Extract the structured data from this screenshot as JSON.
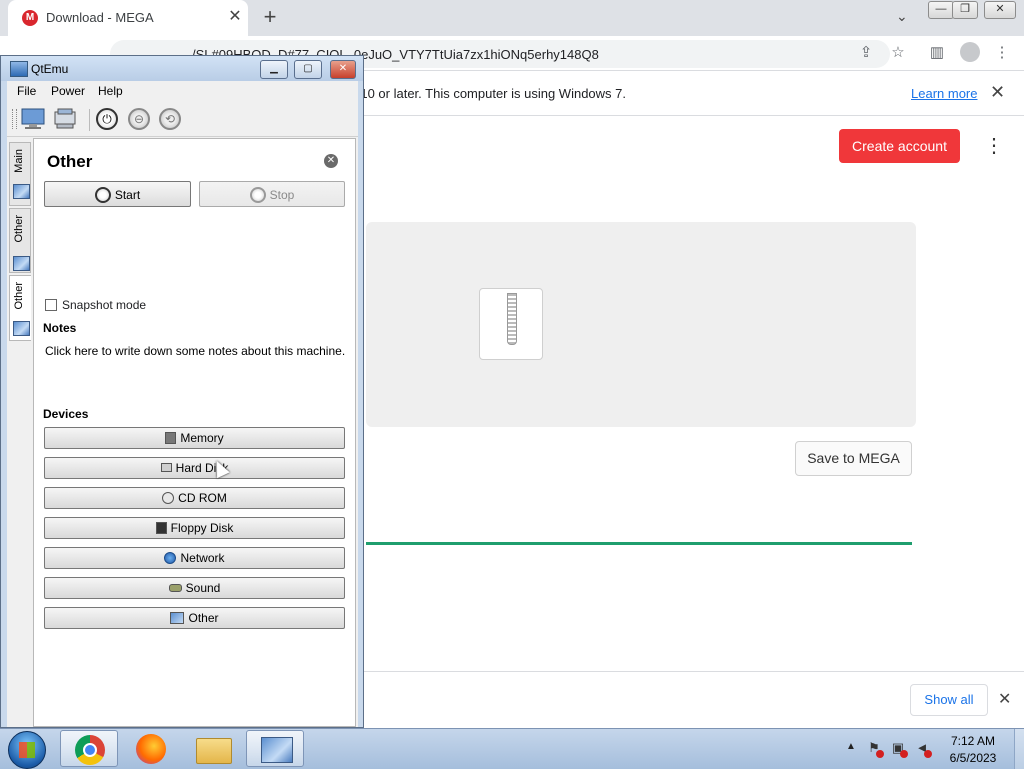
{
  "browser": {
    "tab_title": "Download - MEGA",
    "tab_favicon_letter": "M",
    "url": "/SL#09HBOD_D#77_CIQL_0eJuO_VTY7TtUia7zx1hiONq5erhy148Q8",
    "infobar_text": "10 or later. This computer is using Windows 7.",
    "learn_more": "Learn more"
  },
  "mega": {
    "create_account": "Create account",
    "save_to_mega": "Save to MEGA",
    "show_all": "Show all",
    "download_progress_fraction": 1.0,
    "accent_color": "#f0373a",
    "progress_color": "#1f9e6e"
  },
  "qtemu": {
    "title": "QtEmu",
    "menu": [
      "File",
      "Power",
      "Help"
    ],
    "vertical_tabs": [
      "Main",
      "Other",
      "Other"
    ],
    "panel_title": "Other",
    "start": "Start",
    "stop": "Stop",
    "snapshot_mode": "Snapshot mode",
    "notes_heading": "Notes",
    "notes_placeholder": "Click here to write down some notes about this machine.",
    "devices_heading": "Devices",
    "devices": [
      {
        "label": "Memory",
        "icon": "memory-icon"
      },
      {
        "label": "Hard Disk",
        "icon": "hard-disk-icon"
      },
      {
        "label": "CD ROM",
        "icon": "cd-rom-icon"
      },
      {
        "label": "Floppy Disk",
        "icon": "floppy-disk-icon"
      },
      {
        "label": "Network",
        "icon": "network-icon"
      },
      {
        "label": "Sound",
        "icon": "sound-icon"
      },
      {
        "label": "Other",
        "icon": "other-device-icon"
      }
    ]
  },
  "taskbar": {
    "time": "7:12 AM",
    "date": "6/5/2023"
  }
}
